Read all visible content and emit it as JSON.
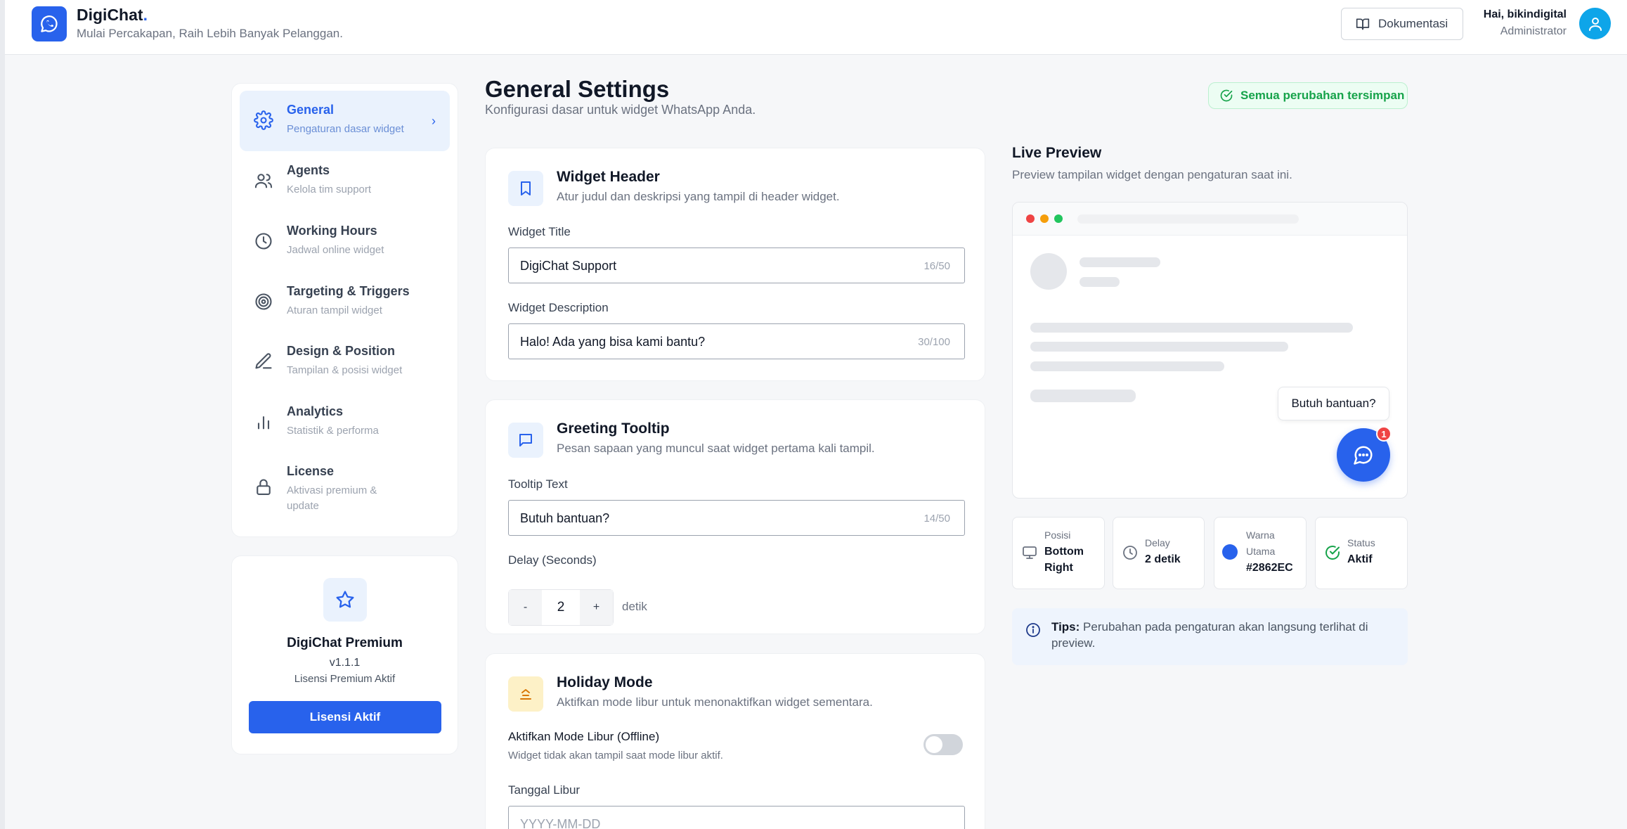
{
  "header": {
    "brand": "DigiChat",
    "brand_dot": ".",
    "tagline": "Mulai Percakapan, Raih Lebih Banyak Pelanggan.",
    "docs_button": "Dokumentasi",
    "greeting": "Hai, bikindigital",
    "role": "Administrator"
  },
  "sidebar": {
    "items": [
      {
        "title": "General",
        "subtitle": "Pengaturan dasar widget",
        "icon": "gear-icon",
        "active": true
      },
      {
        "title": "Agents",
        "subtitle": "Kelola tim support",
        "icon": "users-icon"
      },
      {
        "title": "Working Hours",
        "subtitle": "Jadwal online widget",
        "icon": "clock-icon"
      },
      {
        "title": "Targeting & Triggers",
        "subtitle": "Aturan tampil widget",
        "icon": "target-icon"
      },
      {
        "title": "Design & Position",
        "subtitle": "Tampilan & posisi widget",
        "icon": "pen-icon"
      },
      {
        "title": "Analytics",
        "subtitle": "Statistik & performa",
        "icon": "bar-chart-icon"
      },
      {
        "title": "License",
        "subtitle": "Aktivasi premium & update",
        "icon": "lock-icon"
      }
    ],
    "chevron": "›"
  },
  "premium": {
    "title": "DigiChat Premium",
    "version": "v1.1.1",
    "status": "Lisensi Premium Aktif",
    "button": "Lisensi Aktif"
  },
  "main": {
    "title": "General Settings",
    "subtitle": "Konfigurasi dasar untuk widget WhatsApp Anda.",
    "saved_badge": "Semua perubahan tersimpan",
    "widget_header": {
      "title": "Widget Header",
      "desc": "Atur judul dan deskripsi yang tampil di header widget.",
      "title_label": "Widget Title",
      "title_value": "DigiChat Support",
      "title_count": "16/50",
      "desc_label": "Widget Description",
      "desc_value": "Halo! Ada yang bisa kami bantu?",
      "desc_count": "30/100"
    },
    "greeting": {
      "title": "Greeting Tooltip",
      "desc": "Pesan sapaan yang muncul saat widget pertama kali tampil.",
      "text_label": "Tooltip Text",
      "text_value": "Butuh bantuan?",
      "text_count": "14/50",
      "delay_label": "Delay (Seconds)",
      "minus": "-",
      "delay_value": "2",
      "plus": "+",
      "unit": "detik"
    },
    "holiday": {
      "title": "Holiday Mode",
      "desc": "Aktifkan mode libur untuk menonaktifkan widget sementara.",
      "toggle_label": "Aktifkan Mode Libur (Offline)",
      "toggle_hint": "Widget tidak akan tampil saat mode libur aktif.",
      "toggle_on": false,
      "date_label": "Tanggal Libur",
      "date_placeholder": "YYYY-MM-DD"
    }
  },
  "preview": {
    "title": "Live Preview",
    "subtitle": "Preview tampilan widget dengan pengaturan saat ini.",
    "tooltip": "Butuh bantuan?",
    "badge": "1",
    "stats": [
      {
        "label": "Posisi",
        "value": "Bottom Right",
        "icon": "monitor-icon"
      },
      {
        "label": "Delay",
        "value": "2 detik",
        "icon": "clock-icon"
      },
      {
        "label": "Warna Utama",
        "value": "#2862EC",
        "icon": "color-swatch"
      },
      {
        "label": "Status",
        "value": "Aktif",
        "icon": "check-circle-icon"
      }
    ],
    "tips_label": "Tips:",
    "tips_text": "Perubahan pada pengaturan akan langsung terlihat di preview."
  },
  "colors": {
    "accent": "#2862ec",
    "success": "#16a34a",
    "badge_red": "#ef4444",
    "holiday_icon": "#d97706"
  }
}
